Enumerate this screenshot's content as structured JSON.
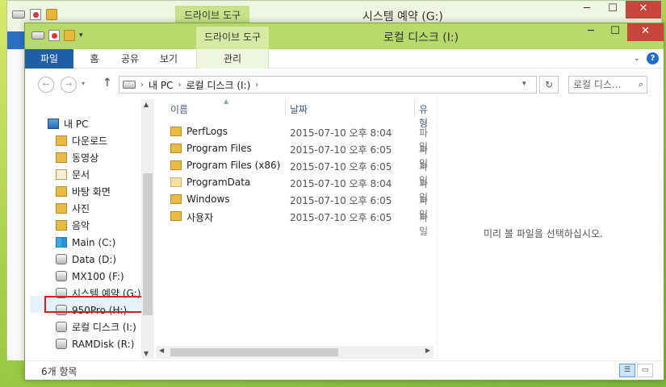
{
  "back_window": {
    "context_tab": "드라이브 도구",
    "title": "시스템 예약 (G:)"
  },
  "window": {
    "context_tab": "드라이브 도구",
    "title": "로컬 디스크 (I:)",
    "controls": {
      "minimize": "─",
      "maximize": "☐",
      "close": "✕"
    }
  },
  "ribbon": {
    "tabs": [
      "파일",
      "홈",
      "공유",
      "보기",
      "관리"
    ]
  },
  "address": {
    "crumbs": [
      "내 PC",
      "로컬 디스크 (I:)"
    ],
    "search_placeholder": "로컬 디스..."
  },
  "nav": {
    "items": [
      {
        "label": "내 PC",
        "icon": "pc-icon"
      },
      {
        "label": "다운로드",
        "icon": "folder-icon"
      },
      {
        "label": "동영상",
        "icon": "folder-icon"
      },
      {
        "label": "문서",
        "icon": "document-folder-icon"
      },
      {
        "label": "바탕 화면",
        "icon": "folder-icon"
      },
      {
        "label": "사진",
        "icon": "folder-icon"
      },
      {
        "label": "음악",
        "icon": "folder-icon"
      },
      {
        "label": "Main (C:)",
        "icon": "windows-drive-icon"
      },
      {
        "label": "Data (D:)",
        "icon": "drive-icon"
      },
      {
        "label": "MX100 (F:)",
        "icon": "drive-icon"
      },
      {
        "label": "시스템 예약 (G:)",
        "icon": "drive-icon"
      },
      {
        "label": "950Pro (H:)",
        "icon": "drive-icon"
      },
      {
        "label": "로컬 디스크 (I:)",
        "icon": "drive-icon",
        "selected": true
      },
      {
        "label": "RAMDisk (R:)",
        "icon": "drive-icon"
      }
    ]
  },
  "columns": {
    "name": "이름",
    "date": "날짜",
    "type": "유형"
  },
  "files": [
    {
      "name": "PerfLogs",
      "date": "2015-07-10 오후 8:04",
      "type": "파일"
    },
    {
      "name": "Program Files",
      "date": "2015-07-10 오후 6:05",
      "type": "파일"
    },
    {
      "name": "Program Files (x86)",
      "date": "2015-07-10 오후 6:05",
      "type": "파일"
    },
    {
      "name": "ProgramData",
      "date": "2015-07-10 오후 8:04",
      "type": "파일"
    },
    {
      "name": "Windows",
      "date": "2015-07-10 오후 6:05",
      "type": "파일"
    },
    {
      "name": "사용자",
      "date": "2015-07-10 오후 6:05",
      "type": "파일"
    }
  ],
  "preview": {
    "message": "미리 볼 파일을 선택하십시오."
  },
  "status": {
    "count": "6개 항목"
  },
  "colors": {
    "titlebar": "#b7d96c",
    "file_tab": "#1f5fa8",
    "close": "#c7463c",
    "highlight": "#d81e1e"
  }
}
